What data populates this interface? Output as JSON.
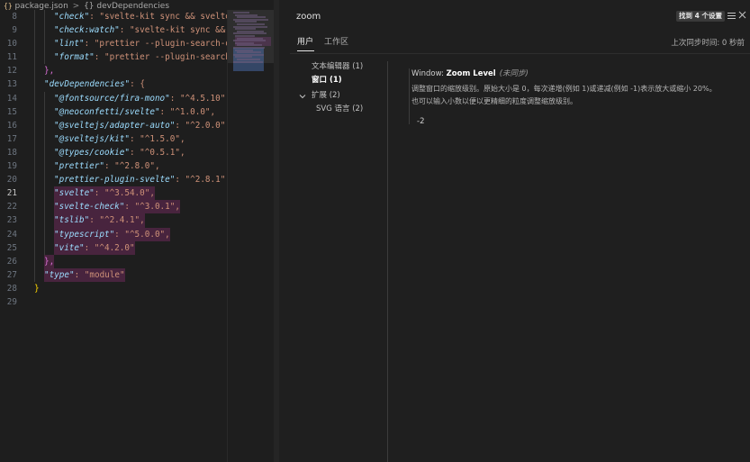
{
  "breadcrumb": {
    "file": "package.json",
    "separator": ">",
    "node_icon": "{}",
    "node": "devDependencies"
  },
  "code_lines": [
    {
      "num": "8",
      "key": "\"check\"",
      "rest": ": \"svelte-kit sync && svelte-"
    },
    {
      "num": "9",
      "key": "\"check:watch\"",
      "rest": ": \"svelte-kit sync && s"
    },
    {
      "num": "10",
      "key": "\"lint\"",
      "rest": ": \"prettier --plugin-search-di"
    },
    {
      "num": "11",
      "key": "\"format\"",
      "rest": ": \"prettier --plugin-search-"
    },
    {
      "num": "12",
      "text": "},"
    },
    {
      "num": "13",
      "key": "\"devDependencies\"",
      "rest": ": {"
    },
    {
      "num": "14",
      "key": "\"@fontsource/fira-mono\"",
      "rest": ": \"^4.5.10\","
    },
    {
      "num": "15",
      "key": "\"@neoconfetti/svelte\"",
      "rest": ": \"^1.0.0\","
    },
    {
      "num": "16",
      "key": "\"@sveltejs/adapter-auto\"",
      "rest": ": \"^2.0.0\","
    },
    {
      "num": "17",
      "key": "\"@sveltejs/kit\"",
      "rest": ": \"^1.5.0\","
    },
    {
      "num": "18",
      "key": "\"@types/cookie\"",
      "rest": ": \"^0.5.1\","
    },
    {
      "num": "19",
      "key": "\"prettier\"",
      "rest": ": \"^2.8.0\","
    },
    {
      "num": "20",
      "key": "\"prettier-plugin-svelte\"",
      "rest": ": \"^2.8.1\","
    },
    {
      "num": "21",
      "key": "\"svelte\"",
      "rest": ": \"^3.54.0\","
    },
    {
      "num": "22",
      "key": "\"svelte-check\"",
      "rest": ": \"^3.0.1\","
    },
    {
      "num": "23",
      "key": "\"tslib\"",
      "rest": ": \"^2.4.1\","
    },
    {
      "num": "24",
      "key": "\"typescript\"",
      "rest": ": \"^5.0.0\","
    },
    {
      "num": "25",
      "key": "\"vite\"",
      "rest": ": \"^4.2.0\""
    },
    {
      "num": "26",
      "text": "},"
    },
    {
      "num": "27",
      "key": "\"type\"",
      "rest": ": \"module\""
    },
    {
      "num": "28",
      "text": "}"
    },
    {
      "num": "29",
      "text": ""
    }
  ],
  "settings": {
    "search_value": "zoom",
    "found_badge": "找到 4 个设置",
    "tabs": {
      "user": "用户",
      "workspace": "工作区"
    },
    "sync_status": "上次同步时间: 0 秒前",
    "toc": [
      "文本编辑器 (1)",
      "窗口 (1)",
      "扩展 (2)",
      "SVG 语言 (2)"
    ],
    "setting": {
      "category": "Window: ",
      "name": "Zoom Level",
      "tag": "(未同步)",
      "description": "调整窗口的缩放级别。原始大小是 0，每次递增(例如 1)或递减(例如 -1)表示放大或缩小 20%。也可以输入小数以便以更精细的粒度调整缩放级别。",
      "value": "-2"
    }
  },
  "colors": {
    "editor_bg": "#1e1e1e",
    "key": "#9cdcfe",
    "string": "#ce9178",
    "bracket_outer": "#ffd700",
    "bracket_inner": "#da70d6",
    "highlight": "#48243e"
  }
}
